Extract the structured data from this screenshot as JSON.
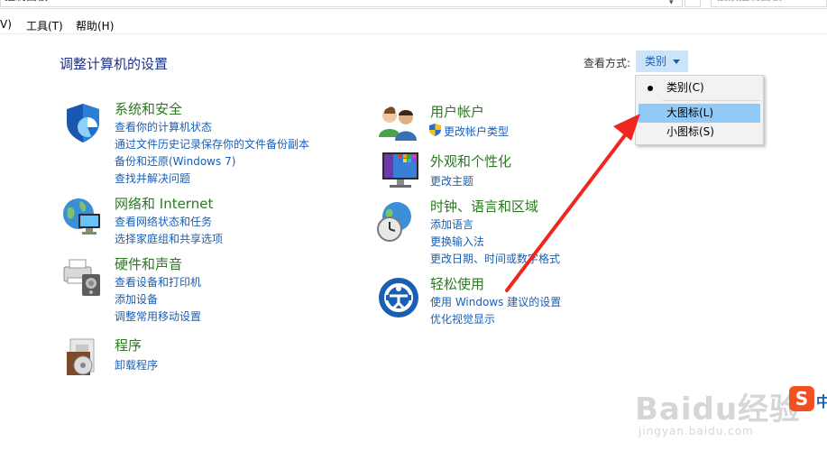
{
  "address": {
    "text": "控制面板",
    "search_placeholder": "搜索控制面板"
  },
  "menu": [
    {
      "label": "V)"
    },
    {
      "label": "工具(T)"
    },
    {
      "label": "帮助(H)"
    }
  ],
  "title": "调整计算机的设置",
  "view_by": {
    "label": "查看方式:",
    "value": "类别"
  },
  "dropdown": {
    "items": [
      {
        "label": "类别(C)",
        "selected": true
      },
      {
        "label": "大图标(L)",
        "hover": true
      },
      {
        "label": "小图标(S)"
      }
    ]
  },
  "categories": {
    "system": {
      "title": "系统和安全",
      "links": [
        "查看你的计算机状态",
        "通过文件历史记录保存你的文件备份副本",
        "备份和还原(Windows 7)",
        "查找并解决问题"
      ]
    },
    "network": {
      "title": "网络和 Internet",
      "links": [
        "查看网络状态和任务",
        "选择家庭组和共享选项"
      ]
    },
    "hardware": {
      "title": "硬件和声音",
      "links": [
        "查看设备和打印机",
        "添加设备",
        "调整常用移动设置"
      ]
    },
    "programs": {
      "title": "程序",
      "links": [
        "卸载程序"
      ]
    },
    "users": {
      "title": "用户帐户",
      "links": [
        "更改帐户类型"
      ]
    },
    "appearance": {
      "title": "外观和个性化",
      "links": [
        "更改主题"
      ]
    },
    "clock": {
      "title": "时钟、语言和区域",
      "links": [
        "添加语言",
        "更换输入法",
        "更改日期、时间或数字格式"
      ]
    },
    "ease": {
      "title": "轻松使用",
      "links": [
        "使用 Windows 建议的设置",
        "优化视觉显示"
      ]
    }
  },
  "watermark": {
    "text": "Baidu经验",
    "sub": "jingyan.baidu.com",
    "logo": "S",
    "zh": "中"
  },
  "colors": {
    "title_blue": "#1e3287",
    "link_blue": "#1a5fb4",
    "category_green": "#2a7a1f",
    "highlight": "#91c9f7",
    "arrow_red": "#f0271f"
  }
}
